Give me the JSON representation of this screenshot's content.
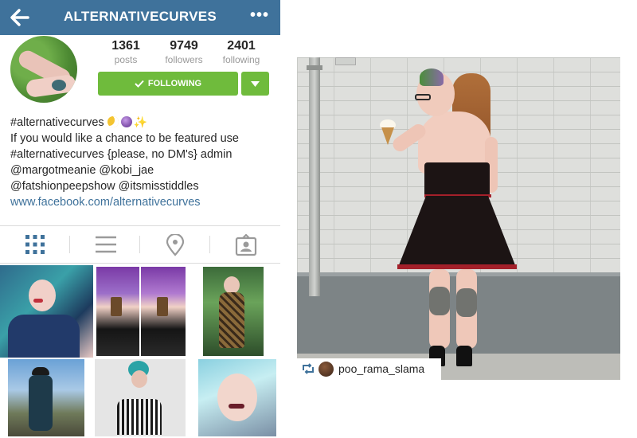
{
  "header": {
    "title": "ALTERNATIVECURVES",
    "more": "•••"
  },
  "stats": {
    "posts_count": "1361",
    "posts_label": "posts",
    "followers_count": "9749",
    "followers_label": "followers",
    "following_count": "2401",
    "following_label": "following"
  },
  "follow_button": {
    "label": "FOLLOWING"
  },
  "bio": {
    "name": "#alternativecurves",
    "lines": [
      "If you would like a chance to be featured use",
      "#alternativecurves {please, no DM's} admin",
      "@margotmeanie @kobi_jae",
      "@fatshionpeepshow @itsmisstiddles"
    ],
    "link": "www.facebook.com/alternativecurves"
  },
  "icons": {
    "back": "back-arrow-icon",
    "grid": "grid-view-icon",
    "list": "list-view-icon",
    "location": "location-pin-icon",
    "tagged": "tagged-photos-icon",
    "repost": "repost-icon"
  },
  "colors": {
    "header_bg": "#3f729b",
    "follow_green": "#6fbb3c",
    "grid_tab_active": "#3f729b",
    "link": "#3f729b"
  },
  "post": {
    "repost_credit": "poo_rama_slama"
  }
}
